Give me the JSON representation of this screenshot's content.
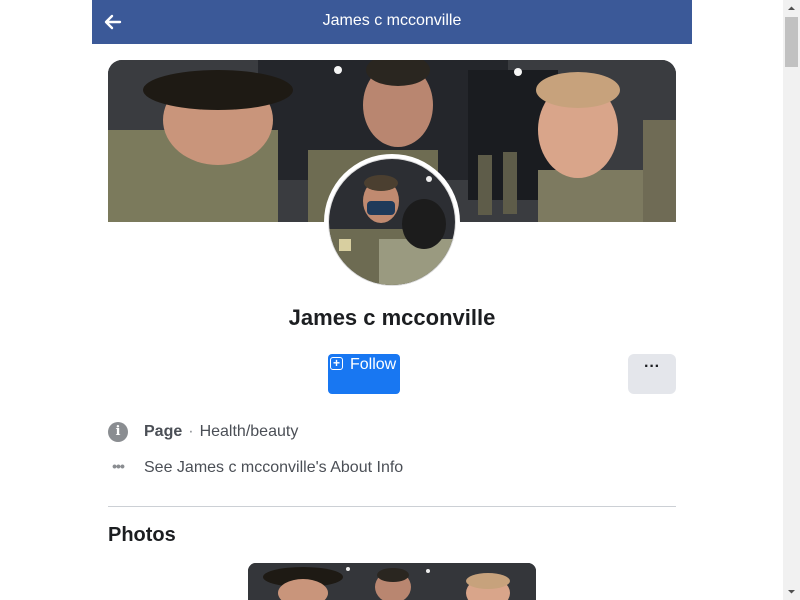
{
  "header": {
    "title": "James c mcconville",
    "back_icon": "arrow-left-icon"
  },
  "profile": {
    "name": "James c mcconville",
    "cover_image": "cover-photo-soldiers",
    "avatar_image": "profile-photo-soldiers"
  },
  "actions": {
    "follow_label": "Follow",
    "follow_icon": "plus-square-icon",
    "more_label": "···"
  },
  "info": {
    "page_type_label": "Page",
    "separator": "·",
    "category": "Health/beauty",
    "about_text": "See James c mcconville's About Info",
    "info_icon": "info-circle-icon",
    "about_icon": "more-dots-icon"
  },
  "photos": {
    "title": "Photos"
  },
  "colors": {
    "header_bg": "#3b5998",
    "follow_bg": "#1877f2",
    "more_bg": "#e4e6eb",
    "text_primary": "#1c1e21",
    "text_secondary": "#4b4f56"
  }
}
